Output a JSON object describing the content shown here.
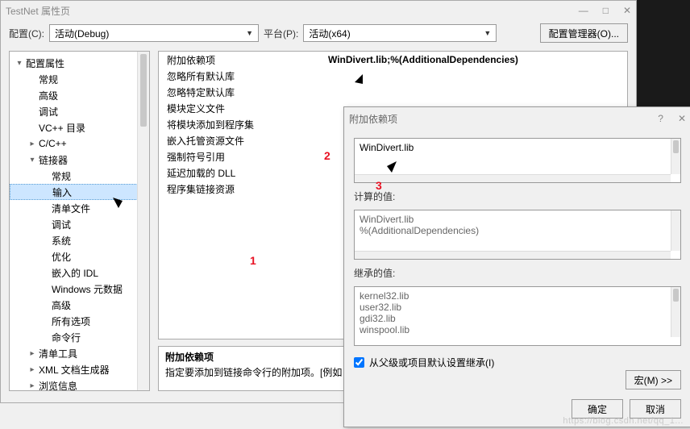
{
  "window": {
    "title": "TestNet 属性页",
    "config_label": "配置(C):",
    "config_value": "活动(Debug)",
    "platform_label": "平台(P):",
    "platform_value": "活动(x64)",
    "config_manager_btn": "配置管理器(O)..."
  },
  "tree": [
    {
      "ind": 0,
      "exp": "▾",
      "label": "配置属性"
    },
    {
      "ind": 1,
      "exp": "",
      "label": "常规"
    },
    {
      "ind": 1,
      "exp": "",
      "label": "高级"
    },
    {
      "ind": 1,
      "exp": "",
      "label": "调试"
    },
    {
      "ind": 1,
      "exp": "",
      "label": "VC++ 目录"
    },
    {
      "ind": 1,
      "exp": "▸",
      "label": "C/C++"
    },
    {
      "ind": 1,
      "exp": "▾",
      "label": "链接器"
    },
    {
      "ind": 2,
      "exp": "",
      "label": "常规"
    },
    {
      "ind": 2,
      "exp": "",
      "label": "输入",
      "sel": true
    },
    {
      "ind": 2,
      "exp": "",
      "label": "清单文件"
    },
    {
      "ind": 2,
      "exp": "",
      "label": "调试"
    },
    {
      "ind": 2,
      "exp": "",
      "label": "系统"
    },
    {
      "ind": 2,
      "exp": "",
      "label": "优化"
    },
    {
      "ind": 2,
      "exp": "",
      "label": "嵌入的 IDL"
    },
    {
      "ind": 2,
      "exp": "",
      "label": "Windows 元数据"
    },
    {
      "ind": 2,
      "exp": "",
      "label": "高级"
    },
    {
      "ind": 2,
      "exp": "",
      "label": "所有选项"
    },
    {
      "ind": 2,
      "exp": "",
      "label": "命令行"
    },
    {
      "ind": 1,
      "exp": "▸",
      "label": "清单工具"
    },
    {
      "ind": 1,
      "exp": "▸",
      "label": "XML 文档生成器"
    },
    {
      "ind": 1,
      "exp": "▸",
      "label": "浏览信息"
    }
  ],
  "props": [
    {
      "name": "附加依赖项",
      "value": "WinDivert.lib;%(AdditionalDependencies)",
      "bold": true
    },
    {
      "name": "忽略所有默认库",
      "value": ""
    },
    {
      "name": "忽略特定默认库",
      "value": ""
    },
    {
      "name": "模块定义文件",
      "value": ""
    },
    {
      "name": "将模块添加到程序集",
      "value": ""
    },
    {
      "name": "嵌入托管资源文件",
      "value": ""
    },
    {
      "name": "强制符号引用",
      "value": ""
    },
    {
      "name": "延迟加载的 DLL",
      "value": ""
    },
    {
      "name": "程序集链接资源",
      "value": ""
    }
  ],
  "desc": {
    "title": "附加依赖项",
    "text": "指定要添加到链接命令行的附加项。[例如"
  },
  "popup": {
    "title": "附加依赖项",
    "input_value": "WinDivert.lib",
    "computed_label": "计算的值:",
    "computed_value": "WinDivert.lib\n%(AdditionalDependencies)",
    "inherited_label": "继承的值:",
    "inherited_values": "kernel32.lib\nuser32.lib\ngdi32.lib\nwinspool.lib",
    "inherit_check": "从父级或项目默认设置继承(I)",
    "macro_btn": "宏(M) >>",
    "ok": "确定",
    "cancel": "取消"
  },
  "annotations": {
    "a1": "1",
    "a2": "2",
    "a3": "3"
  },
  "watermark": "https://blog.csdn.net/qq_1..."
}
